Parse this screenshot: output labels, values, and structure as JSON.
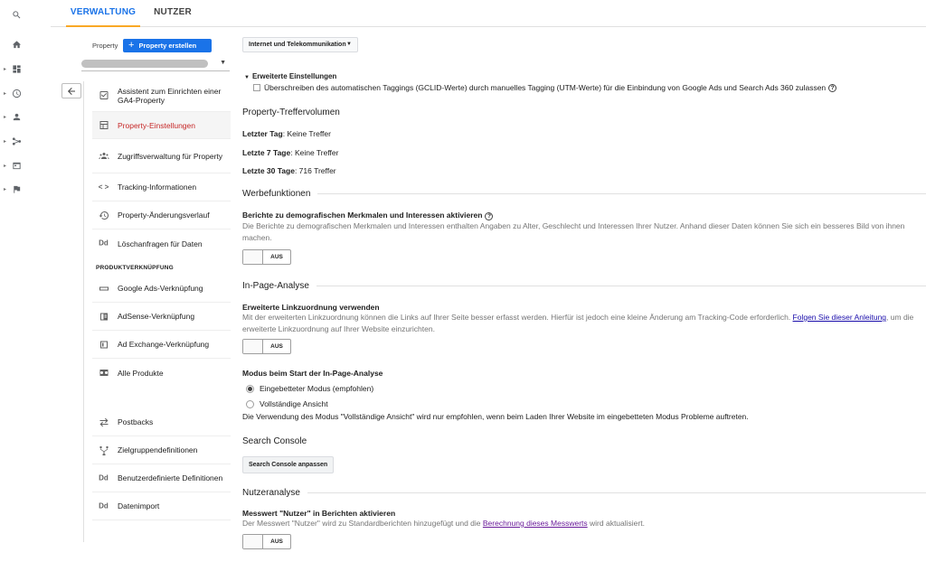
{
  "rail": {
    "items": [
      {
        "name": "search-icon"
      },
      {
        "name": "home-icon"
      },
      {
        "name": "dashboard-icon"
      },
      {
        "name": "clock-icon"
      },
      {
        "name": "person-icon"
      },
      {
        "name": "acquisition-icon"
      },
      {
        "name": "behavior-icon"
      },
      {
        "name": "flag-icon"
      }
    ]
  },
  "tabs": [
    {
      "label": "VERWALTUNG",
      "active": true
    },
    {
      "label": "NUTZER",
      "active": false
    }
  ],
  "admin": {
    "property_label": "Property",
    "create_button": "Property erstellen",
    "nav": [
      {
        "label": "Assistent zum Einrichten einer GA4-Property",
        "icon": "checkbox-icon"
      },
      {
        "label": "Property-Einstellungen",
        "icon": "settings-panel-icon",
        "active": true
      },
      {
        "label": "Zugriffsverwaltung für Property",
        "icon": "users-icon"
      },
      {
        "label": "Tracking-Informationen",
        "icon": "code-icon"
      },
      {
        "label": "Property-Änderungsverlauf",
        "icon": "history-icon"
      },
      {
        "label": "Löschanfragen für Daten",
        "icon": "dd-icon",
        "glyph": "Dd"
      }
    ],
    "section_label": "PRODUKTVERKNÜPFUNG",
    "product_nav": [
      {
        "label": "Google Ads-Verknüpfung",
        "icon": "google-ads-icon"
      },
      {
        "label": "AdSense-Verknüpfung",
        "icon": "adsense-icon"
      },
      {
        "label": "Ad Exchange-Verknüpfung",
        "icon": "ad-exchange-icon"
      },
      {
        "label": "Alle Produkte",
        "icon": "all-products-icon"
      }
    ],
    "other_nav": [
      {
        "label": "Postbacks",
        "icon": "postbacks-icon"
      },
      {
        "label": "Zielgruppendefinitionen",
        "icon": "audience-icon"
      },
      {
        "label": "Benutzerdefinierte Definitionen",
        "icon": "dd-icon",
        "glyph": "Dd"
      },
      {
        "label": "Datenimport",
        "icon": "dd-icon",
        "glyph": "Dd"
      }
    ]
  },
  "main": {
    "category_select": "Internet und Telekommunikation",
    "advanced": {
      "header": "Erweiterte Einstellungen",
      "checkbox_label": "Überschreiben des automatischen Taggings (GCLID-Werte) durch manuelles Tagging (UTM-Werte) für die Einbindung von Google Ads und Search Ads 360 zulassen"
    },
    "hits": {
      "title": "Property-Treffervolumen",
      "rows": [
        {
          "label": "Letzter Tag",
          "value": ": Keine Treffer"
        },
        {
          "label": "Letzte 7 Tage",
          "value": ": Keine Treffer"
        },
        {
          "label": "Letzte 30 Tage",
          "value": ": 716 Treffer"
        }
      ]
    },
    "ads": {
      "title": "Werbefunktionen",
      "label": "Berichte zu demografischen Merkmalen und Interessen aktivieren",
      "desc": "Die Berichte zu demografischen Merkmalen und Interessen enthalten Angaben zu Alter, Geschlecht und Interessen Ihrer Nutzer. Anhand dieser Daten können Sie sich ein besseres Bild von ihnen machen.",
      "toggle": "AUS"
    },
    "inpage": {
      "title": "In-Page-Analyse",
      "label": "Erweiterte Linkzuordnung verwenden",
      "desc_before": "Mit der erweiterten Linkzuordnung können die Links auf Ihrer Seite besser erfasst werden. Hierfür ist jedoch eine kleine Änderung am Tracking-Code erforderlich. ",
      "desc_link": "Folgen Sie dieser Anleitung",
      "desc_after": ", um die erweiterte Linkzuordnung auf Ihrer Website einzurichten.",
      "toggle": "AUS",
      "mode_label": "Modus beim Start der In-Page-Analyse",
      "option_embedded": "Eingebetteter Modus (empfohlen)",
      "option_full": "Vollständige Ansicht",
      "note": "Die Verwendung des Modus \"Vollständige Ansicht\" wird nur empfohlen, wenn beim Laden Ihrer Website im eingebetteten Modus Probleme auftreten."
    },
    "search_console": {
      "title": "Search Console",
      "button": "Search Console anpassen"
    },
    "users": {
      "title": "Nutzeranalyse",
      "label": "Messwert \"Nutzer\" in Berichten aktivieren",
      "desc_before": "Der Messwert \"Nutzer\" wird zu Standardberichten hinzugefügt und die ",
      "desc_link": "Berechnung dieses Messwerts",
      "desc_after": " wird aktualisiert.",
      "toggle": "AUS"
    }
  }
}
